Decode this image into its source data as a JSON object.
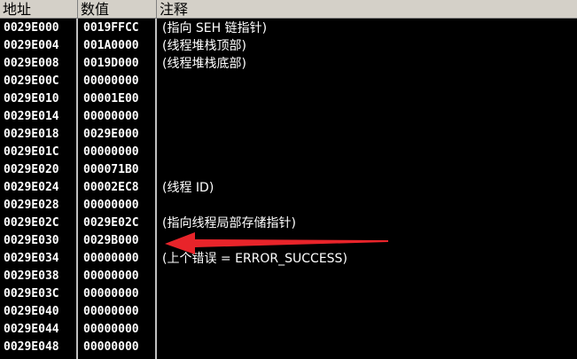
{
  "header": {
    "address": "地址",
    "value": "数值",
    "comment": "注释"
  },
  "rows": [
    {
      "address": "0029E000",
      "value": "0019FFCC",
      "comment": "(指向 SEH 链指针)"
    },
    {
      "address": "0029E004",
      "value": "001A0000",
      "comment": "(线程堆栈顶部)"
    },
    {
      "address": "0029E008",
      "value": "0019D000",
      "comment": "(线程堆栈底部)"
    },
    {
      "address": "0029E00C",
      "value": "00000000",
      "comment": ""
    },
    {
      "address": "0029E010",
      "value": "00001E00",
      "comment": ""
    },
    {
      "address": "0029E014",
      "value": "00000000",
      "comment": ""
    },
    {
      "address": "0029E018",
      "value": "0029E000",
      "comment": ""
    },
    {
      "address": "0029E01C",
      "value": "00000000",
      "comment": ""
    },
    {
      "address": "0029E020",
      "value": "000071B0",
      "comment": ""
    },
    {
      "address": "0029E024",
      "value": "00002EC8",
      "comment": "(线程 ID)"
    },
    {
      "address": "0029E028",
      "value": "00000000",
      "comment": ""
    },
    {
      "address": "0029E02C",
      "value": "0029E02C",
      "comment": "(指向线程局部存储指针)"
    },
    {
      "address": "0029E030",
      "value": "0029B000",
      "comment": ""
    },
    {
      "address": "0029E034",
      "value": "00000000",
      "comment": "(上个错误 = ERROR_SUCCESS)"
    },
    {
      "address": "0029E038",
      "value": "00000000",
      "comment": ""
    },
    {
      "address": "0029E03C",
      "value": "00000000",
      "comment": ""
    },
    {
      "address": "0029E040",
      "value": "00000000",
      "comment": ""
    },
    {
      "address": "0029E044",
      "value": "00000000",
      "comment": ""
    },
    {
      "address": "0029E048",
      "value": "00000000",
      "comment": ""
    }
  ],
  "colors": {
    "background": "#000000",
    "text": "#ffffff",
    "header_bg": "#d4d0c8",
    "annotation_arrow": "#e8242a"
  },
  "annotation": {
    "icon": "red-arrow-icon",
    "points_to_row": "0029E030"
  }
}
